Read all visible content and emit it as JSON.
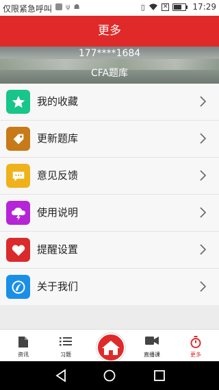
{
  "status_bar": {
    "carrier": "仅限紧急呼叫",
    "time": "17:29"
  },
  "header": {
    "title": "更多"
  },
  "profile": {
    "phone": "177****1684",
    "course": "CFA题库"
  },
  "menu": {
    "items": [
      {
        "label": "我的收藏",
        "icon": "star-icon",
        "color": "#18c58a"
      },
      {
        "label": "更新题库",
        "icon": "tag-icon",
        "color": "#c77a17"
      },
      {
        "label": "意见反馈",
        "icon": "chat-bubble-icon",
        "color": "#f0b21a"
      },
      {
        "label": "使用说明",
        "icon": "cloud-lightning-icon",
        "color": "#b624d8"
      },
      {
        "label": "提醒设置",
        "icon": "heart-icon",
        "color": "#d92b2b"
      },
      {
        "label": "关于我们",
        "icon": "compass-icon",
        "color": "#1a8fe8"
      }
    ]
  },
  "tabbar": {
    "tabs": [
      {
        "label": "资讯",
        "icon": "document-icon"
      },
      {
        "label": "习题",
        "icon": "list-icon"
      },
      {
        "label": "",
        "icon": "home-icon"
      },
      {
        "label": "直播课",
        "icon": "video-camera-icon"
      },
      {
        "label": "更多",
        "icon": "stopwatch-icon",
        "active": true
      }
    ],
    "accent": "#e02a2a"
  }
}
